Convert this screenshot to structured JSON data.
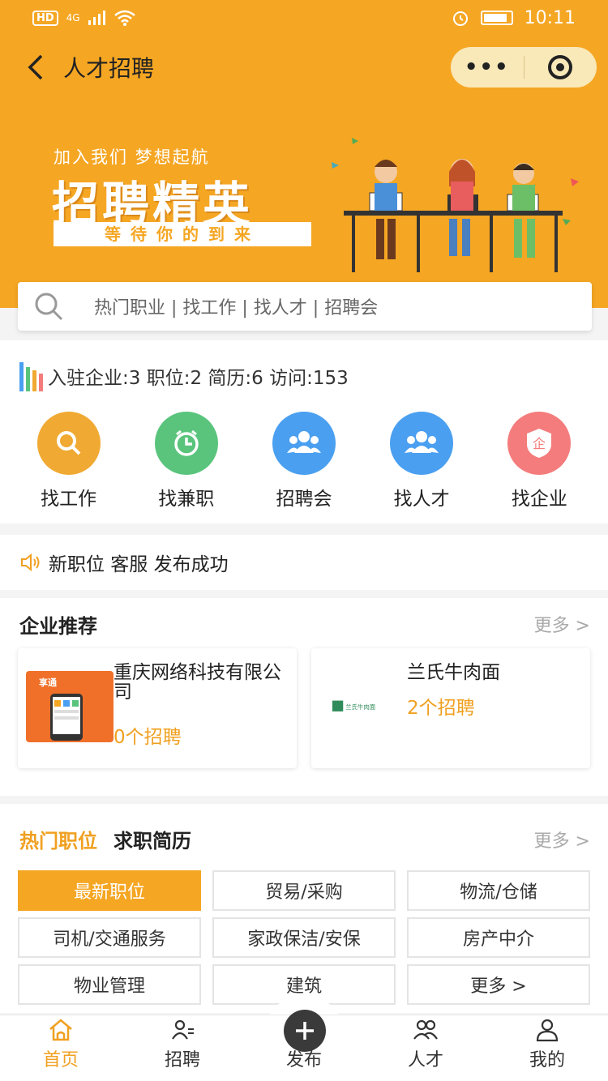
{
  "status_bar": {
    "network_badge": "HD",
    "signal_label": "4G",
    "time": "10:11"
  },
  "navbar": {
    "title": "人才招聘",
    "menu_dots": "•••"
  },
  "banner": {
    "slogan_small": "加入我们 梦想起航",
    "slogan_big": "招聘精英",
    "slogan_box": "等待你的到来"
  },
  "search": {
    "placeholder": "热门职业 | 找工作 | 找人才 | 招聘会"
  },
  "stats": {
    "text": "入驻企业:3 职位:2 简历:6 访问:153"
  },
  "quick_actions": [
    {
      "label": "找工作",
      "color": "#f0a932",
      "icon": "search-icon"
    },
    {
      "label": "找兼职",
      "color": "#5ac47d",
      "icon": "clock-icon"
    },
    {
      "label": "招聘会",
      "color": "#4a9ff0",
      "icon": "people-icon"
    },
    {
      "label": "找人才",
      "color": "#4a9ff0",
      "icon": "people-icon"
    },
    {
      "label": "找企业",
      "color": "#f47c7c",
      "icon": "enterprise-icon"
    }
  ],
  "notice": {
    "text": "新职位 客服 发布成功"
  },
  "enterprise": {
    "title": "企业推荐",
    "more": "更多 >",
    "items": [
      {
        "name": "重庆网络科技有限公司",
        "count": "0个招聘",
        "logo_text": "享通"
      },
      {
        "name": "兰氏牛肉面",
        "count": "2个招聘",
        "logo_text": "兰氏牛肉面"
      }
    ]
  },
  "hot": {
    "tab_active": "热门职位",
    "tab_inactive": "求职简历",
    "more": "更多 >",
    "categories": [
      "最新职位",
      "贸易/采购",
      "物流/仓储",
      "司机/交通服务",
      "家政保洁/安保",
      "房产中介",
      "物业管理",
      "建筑",
      "更多 >"
    ]
  },
  "tabbar": {
    "home": "首页",
    "recruit": "招聘",
    "publish": "发布",
    "talent": "人才",
    "mine": "我的"
  },
  "colors": {
    "accent": "#f5a623",
    "accent_text": "#f0a020"
  }
}
